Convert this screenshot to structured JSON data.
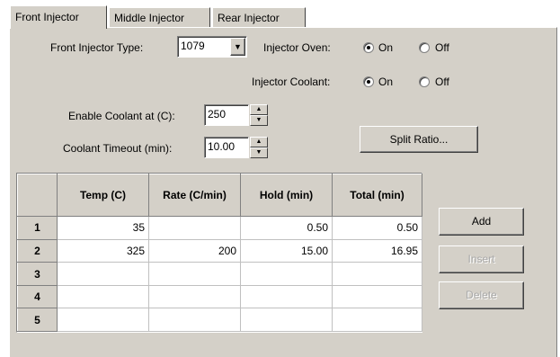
{
  "tabs": [
    {
      "label": "Front Injector",
      "active": true
    },
    {
      "label": "Middle Injector",
      "active": false
    },
    {
      "label": "Rear Injector",
      "active": false
    }
  ],
  "injector_type": {
    "label": "Front Injector Type:",
    "value": "1079"
  },
  "injector_oven": {
    "label": "Injector Oven:",
    "on_label": "On",
    "off_label": "Off",
    "selected": "On"
  },
  "injector_coolant": {
    "label": "Injector Coolant:",
    "on_label": "On",
    "off_label": "Off",
    "selected": "On"
  },
  "enable_coolant": {
    "label": "Enable Coolant at (C):",
    "value": "250"
  },
  "coolant_timeout": {
    "label": "Coolant Timeout (min):",
    "value": "10.00"
  },
  "split_ratio_label": "Split Ratio...",
  "table": {
    "columns": [
      "",
      "Temp (C)",
      "Rate (C/min)",
      "Hold (min)",
      "Total (min)"
    ],
    "rows": [
      {
        "num": "1",
        "temp": "35",
        "rate": "",
        "hold": "0.50",
        "total": "0.50"
      },
      {
        "num": "2",
        "temp": "325",
        "rate": "200",
        "hold": "15.00",
        "total": "16.95"
      },
      {
        "num": "3",
        "temp": "",
        "rate": "",
        "hold": "",
        "total": ""
      },
      {
        "num": "4",
        "temp": "",
        "rate": "",
        "hold": "",
        "total": ""
      },
      {
        "num": "5",
        "temp": "",
        "rate": "",
        "hold": "",
        "total": ""
      }
    ]
  },
  "buttons": {
    "add": "Add",
    "insert": "Insert",
    "delete": "Delete"
  },
  "icons": {
    "dropdown": "chevron-down-icon",
    "spin_up": "arrow-up-icon",
    "spin_down": "arrow-down-icon"
  }
}
